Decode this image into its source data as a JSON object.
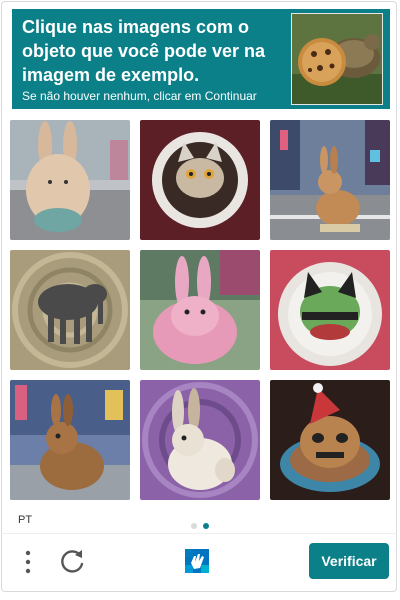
{
  "header": {
    "title": "Clique nas imagens com o objeto que você pode ver na imagem de exemplo.",
    "subtitle": "Se não houver nenhum, clicar em Continuar",
    "example_image": "cookie-and-turtle-example"
  },
  "grid": {
    "tiles": [
      {
        "subject": "rabbit-blurred-street"
      },
      {
        "subject": "cat-face-plate"
      },
      {
        "subject": "rabbit-city-street"
      },
      {
        "subject": "elephant-patterned"
      },
      {
        "subject": "pink-rabbit"
      },
      {
        "subject": "green-cat-cake"
      },
      {
        "subject": "brown-rabbit-city"
      },
      {
        "subject": "white-rabbit-purple"
      },
      {
        "subject": "cat-santa-cake"
      }
    ]
  },
  "footer": {
    "language": "PT",
    "page_indicator": {
      "current": 2,
      "total": 2
    },
    "verify_label": "Verificar",
    "menu_icon": "vertical-dots-icon",
    "refresh_icon": "refresh-icon",
    "logo_icon": "hcaptcha-hand-logo"
  },
  "colors": {
    "accent": "#0b8089",
    "text_on_accent": "#ffffff"
  }
}
